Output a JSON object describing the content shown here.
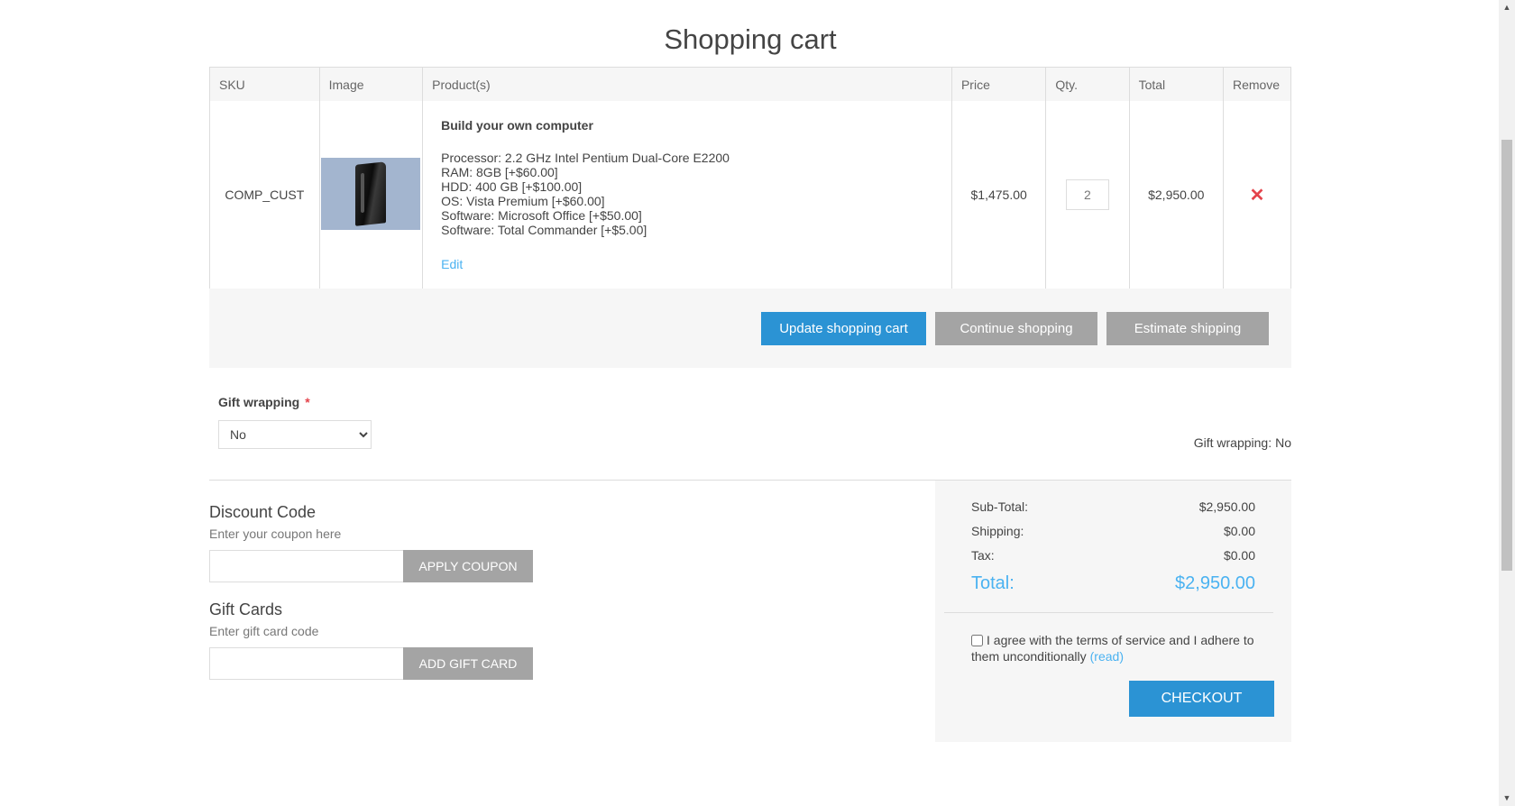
{
  "page_title": "Shopping cart",
  "table": {
    "headers": {
      "sku": "SKU",
      "image": "Image",
      "products": "Product(s)",
      "price": "Price",
      "qty": "Qty.",
      "total": "Total",
      "remove": "Remove"
    },
    "items": [
      {
        "sku": "COMP_CUST",
        "product_name": "Build your own computer",
        "attributes": [
          "Processor: 2.2 GHz Intel Pentium Dual-Core E2200",
          "RAM: 8GB [+$60.00]",
          "HDD: 400 GB [+$100.00]",
          "OS: Vista Premium [+$60.00]",
          "Software: Microsoft Office [+$50.00]",
          "Software: Total Commander [+$5.00]"
        ],
        "edit_label": "Edit",
        "price": "$1,475.00",
        "quantity": "2",
        "total": "$2,950.00",
        "remove_glyph": "✕",
        "image_icon": "desktop-tower-icon"
      }
    ]
  },
  "actions": {
    "update_label": "Update shopping cart",
    "continue_label": "Continue shopping",
    "estimate_label": "Estimate shipping"
  },
  "gift_wrapping": {
    "label": "Gift wrapping",
    "required_mark": "*",
    "selected": "No",
    "info_label": "Gift wrapping:",
    "info_value": "No"
  },
  "discount": {
    "title": "Discount Code",
    "hint": "Enter your coupon here",
    "input_value": "",
    "button_label": "APPLY COUPON"
  },
  "gift_cards": {
    "title": "Gift Cards",
    "hint": "Enter gift card code",
    "input_value": "",
    "button_label": "ADD GIFT CARD"
  },
  "totals": {
    "subtotal_label": "Sub-Total:",
    "subtotal_value": "$2,950.00",
    "shipping_label": "Shipping:",
    "shipping_value": "$0.00",
    "tax_label": "Tax:",
    "tax_value": "$0.00",
    "total_label": "Total:",
    "total_value": "$2,950.00"
  },
  "terms": {
    "text": "I agree with the terms of service and I adhere to them unconditionally",
    "read_link": "(read)",
    "checked": false
  },
  "checkout_label": "CHECKOUT",
  "colors": {
    "primary_button": "#2b93d4",
    "secondary_button": "#a4a4a4",
    "accent_link": "#4ab2f1",
    "remove_red": "#e4434b",
    "panel_bg": "#f6f6f6"
  }
}
